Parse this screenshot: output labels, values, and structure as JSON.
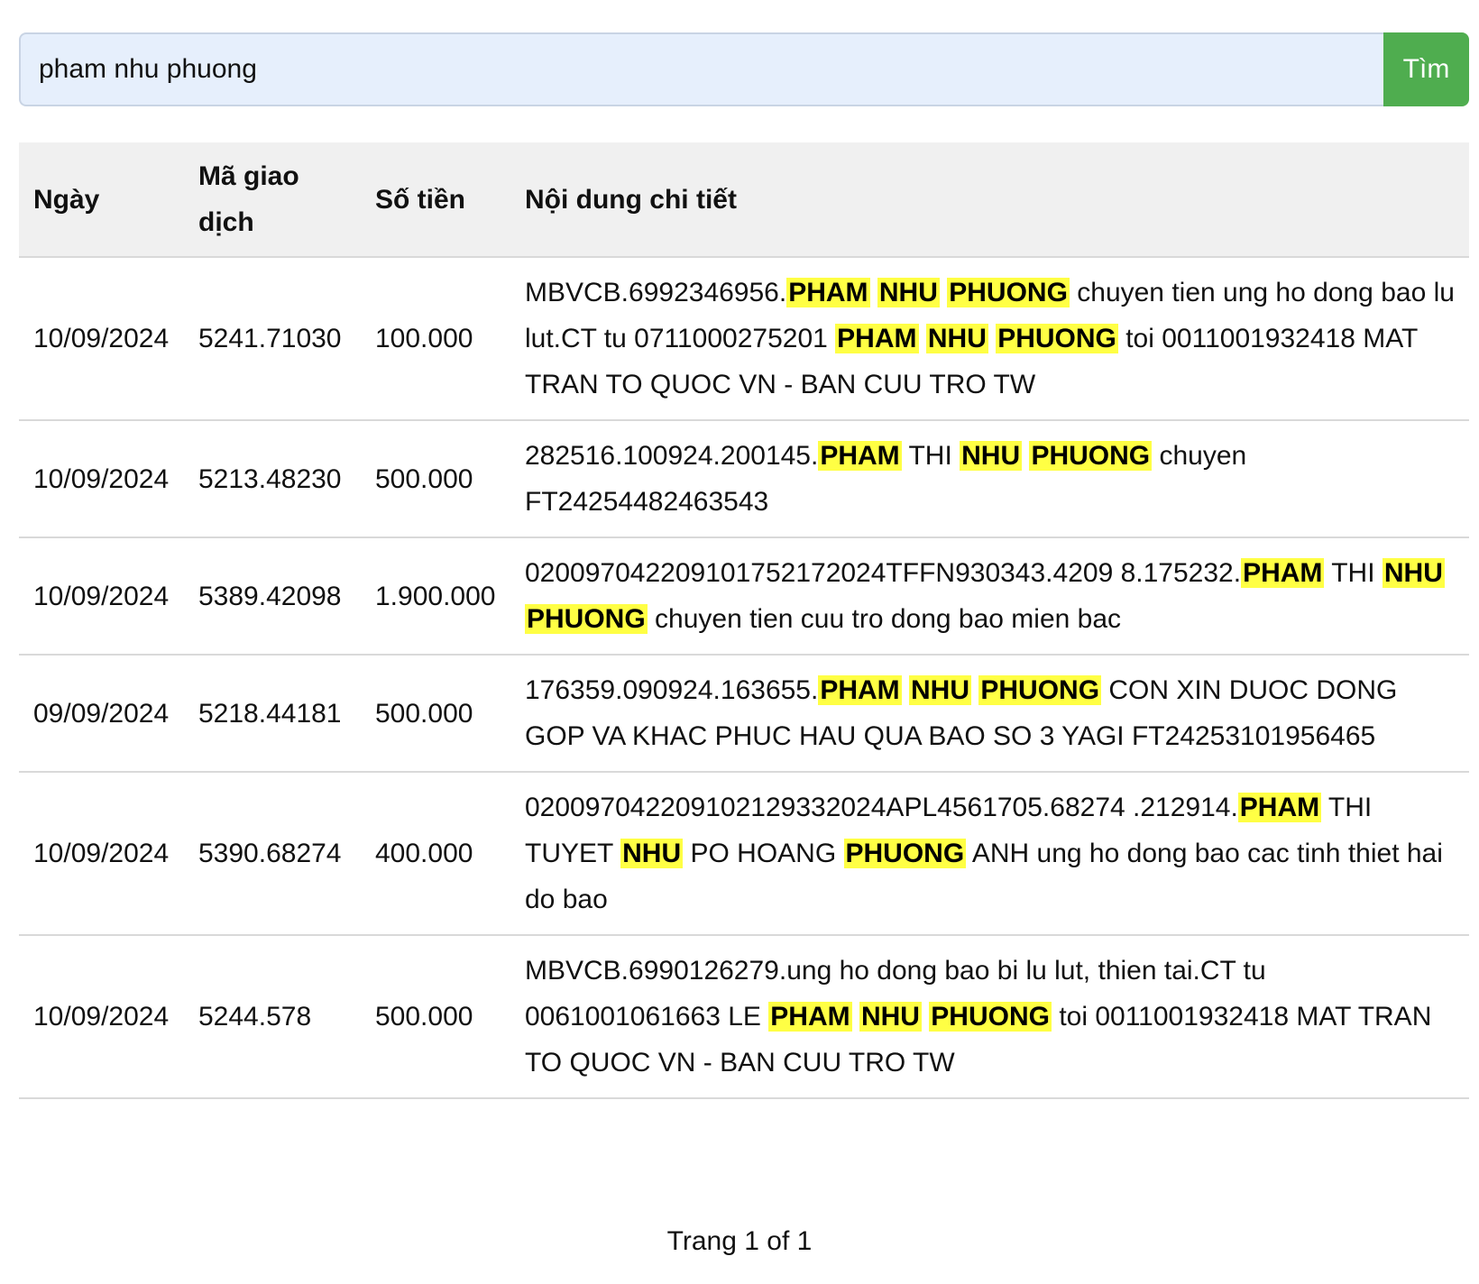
{
  "search": {
    "value": "pham nhu phuong",
    "button_label": "Tìm"
  },
  "table": {
    "headers": [
      "Ngày",
      "Mã giao dịch",
      "Số tiền",
      "Nội dung chi tiết"
    ],
    "rows": [
      {
        "date": "10/09/2024",
        "code": "5241.71030",
        "amount": "100.000",
        "detail": [
          {
            "t": "MBVCB.6992346956."
          },
          {
            "t": "PHAM",
            "hl": true
          },
          {
            "t": " "
          },
          {
            "t": "NHU",
            "hl": true
          },
          {
            "t": " "
          },
          {
            "t": "PHUONG",
            "hl": true
          },
          {
            "t": " chuyen tien ung ho dong bao lu lut.CT tu 0711000275201 "
          },
          {
            "t": "PHAM",
            "hl": true
          },
          {
            "t": " "
          },
          {
            "t": "NHU",
            "hl": true
          },
          {
            "t": " "
          },
          {
            "t": "PHUONG",
            "hl": true
          },
          {
            "t": " toi 0011001932418 MAT TRAN TO QUOC VN - BAN CUU TRO TW"
          }
        ]
      },
      {
        "date": "10/09/2024",
        "code": "5213.48230",
        "amount": "500.000",
        "detail": [
          {
            "t": "282516.100924.200145."
          },
          {
            "t": "PHAM",
            "hl": true
          },
          {
            "t": " THI "
          },
          {
            "t": "NHU",
            "hl": true
          },
          {
            "t": " "
          },
          {
            "t": "PHUONG",
            "hl": true
          },
          {
            "t": " chuyen FT24254482463543"
          }
        ]
      },
      {
        "date": "10/09/2024",
        "code": "5389.42098",
        "amount": "1.900.000",
        "detail": [
          {
            "t": "020097042209101752172024TFFN930343.4209 8.175232."
          },
          {
            "t": "PHAM",
            "hl": true
          },
          {
            "t": " THI "
          },
          {
            "t": "NHU",
            "hl": true
          },
          {
            "t": " "
          },
          {
            "t": "PHUONG",
            "hl": true
          },
          {
            "t": " chuyen tien cuu tro dong bao mien bac"
          }
        ]
      },
      {
        "date": "09/09/2024",
        "code": "5218.44181",
        "amount": "500.000",
        "detail": [
          {
            "t": "176359.090924.163655."
          },
          {
            "t": "PHAM",
            "hl": true
          },
          {
            "t": " "
          },
          {
            "t": "NHU",
            "hl": true
          },
          {
            "t": " "
          },
          {
            "t": "PHUONG",
            "hl": true
          },
          {
            "t": " CON XIN DUOC DONG GOP VA KHAC PHUC HAU QUA BAO SO 3 YAGI FT24253101956465"
          }
        ]
      },
      {
        "date": "10/09/2024",
        "code": "5390.68274",
        "amount": "400.000",
        "detail": [
          {
            "t": "020097042209102129332024APL4561705.68274 .212914."
          },
          {
            "t": "PHAM",
            "hl": true
          },
          {
            "t": " THI TUYET "
          },
          {
            "t": "NHU",
            "hl": true
          },
          {
            "t": " PO HOANG "
          },
          {
            "t": "PHUONG",
            "hl": true
          },
          {
            "t": " ANH ung ho dong bao cac tinh thiet hai do bao"
          }
        ]
      },
      {
        "date": "10/09/2024",
        "code": "5244.578",
        "amount": "500.000",
        "detail": [
          {
            "t": "MBVCB.6990126279.ung ho dong bao bi lu lut, thien tai.CT tu 0061001061663 LE "
          },
          {
            "t": "PHAM",
            "hl": true
          },
          {
            "t": " "
          },
          {
            "t": "NHU",
            "hl": true
          },
          {
            "t": " "
          },
          {
            "t": "PHUONG",
            "hl": true
          },
          {
            "t": " toi 0011001932418 MAT TRAN TO QUOC VN - BAN CUU TRO TW"
          }
        ]
      }
    ]
  },
  "pagination": {
    "text": "Trang 1 of 1"
  }
}
